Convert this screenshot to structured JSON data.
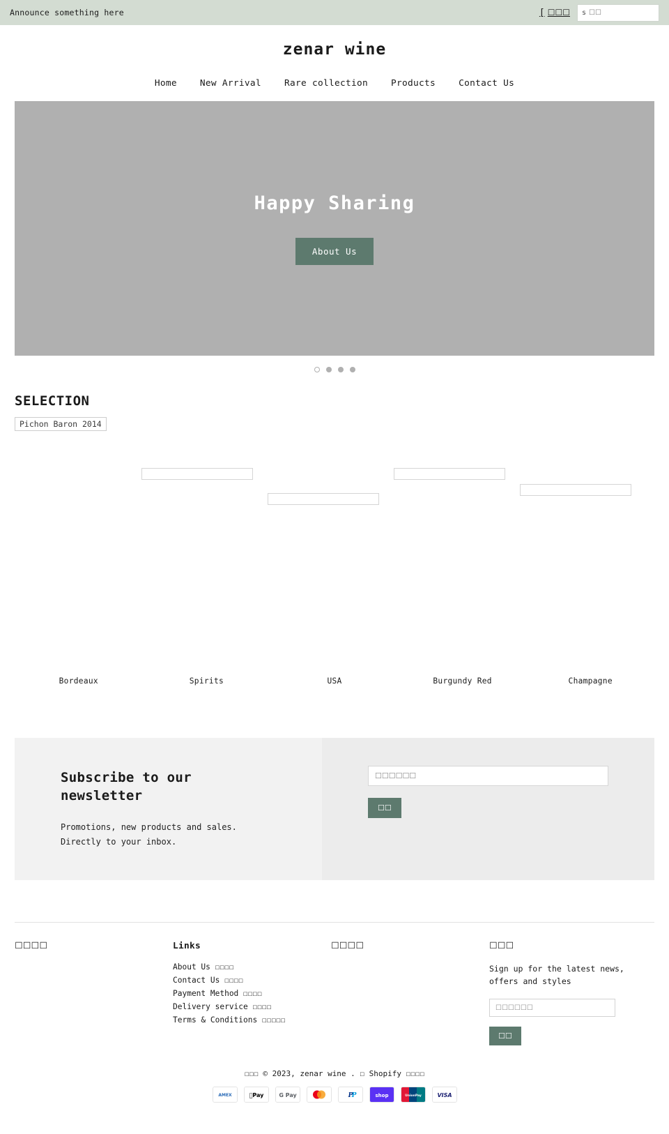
{
  "announcement": {
    "text": "Announce something here",
    "cart_bracket": "[",
    "cart_label": "☐☐☐",
    "search_glyph": "s",
    "search_placeholder": "☐☐"
  },
  "header": {
    "site_title": "zenar wine",
    "nav": [
      {
        "label": "Home"
      },
      {
        "label": "New Arrival"
      },
      {
        "label": "Rare collection"
      },
      {
        "label": "Products"
      },
      {
        "label": "Contact Us"
      }
    ]
  },
  "hero": {
    "title": "Happy Sharing",
    "button_label": "About Us",
    "slide_count": 4,
    "active_slide": 1,
    "bg_color": "#b0b0b0",
    "accent_color": "#5d7a6e"
  },
  "selection": {
    "section_title": "SELECTION",
    "broken_image_alt": "Pichon Baron 2014",
    "products": [
      {
        "name": "Bordeaux"
      },
      {
        "name": "Spirits"
      },
      {
        "name": "USA"
      },
      {
        "name": "Burgundy Red"
      },
      {
        "name": "Champagne"
      }
    ]
  },
  "newsletter": {
    "heading": "Subscribe to our newsletter",
    "subtext": "Promotions, new products and sales. Directly to your inbox.",
    "input_placeholder": "☐☐☐☐☐☐",
    "button_label": "☐☐"
  },
  "footer": {
    "col1_heading": "☐☐☐☐",
    "col2_heading": "Links",
    "col2_links": [
      {
        "label": "About Us ☐☐☐☐"
      },
      {
        "label": "Contact Us ☐☐☐☐"
      },
      {
        "label": "Payment Method ☐☐☐☐"
      },
      {
        "label": "Delivery service ☐☐☐☐"
      },
      {
        "label": "Terms & Conditions ☐☐☐☐☐"
      }
    ],
    "col3_heading": "☐☐☐☐",
    "col4_heading": "☐☐☐",
    "col4_note": "Sign up for the latest news, offers and styles",
    "col4_placeholder": "☐☐☐☐☐☐",
    "col4_button": "☐☐",
    "copyright_prefix": "☐☐☐ © 2023, zenar wine . ☐ Shopify ☐☐☐☐",
    "payment_methods": [
      {
        "name": "american-express"
      },
      {
        "name": "apple-pay"
      },
      {
        "name": "google-pay"
      },
      {
        "name": "mastercard"
      },
      {
        "name": "paypal"
      },
      {
        "name": "shop-pay"
      },
      {
        "name": "union-pay"
      },
      {
        "name": "visa"
      }
    ]
  }
}
